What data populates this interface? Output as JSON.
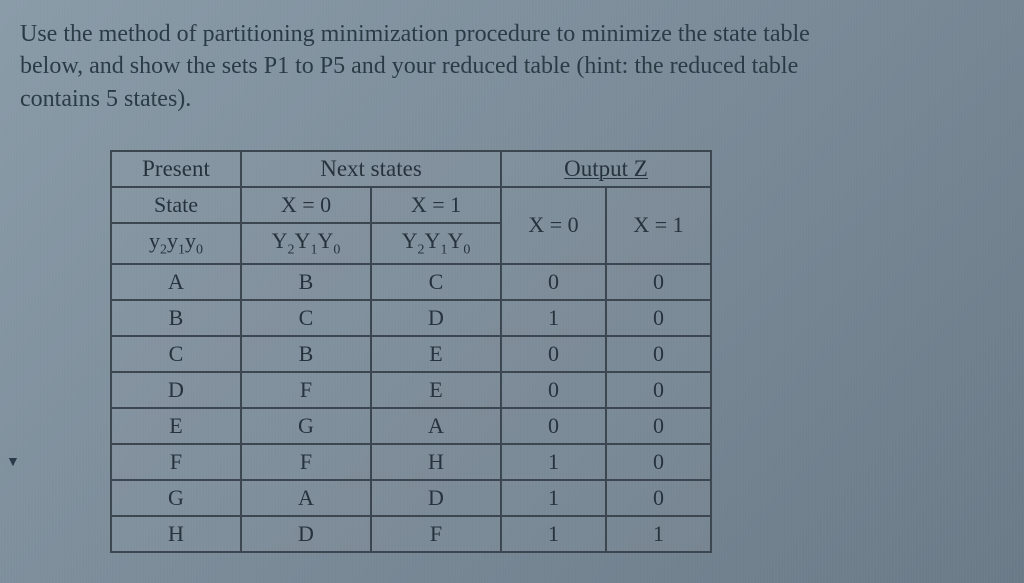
{
  "question": {
    "line1": "Use the method of partitioning minimization procedure to minimize the state table",
    "line2": "below, and show the sets P1 to P5 and your reduced table (hint: the reduced table",
    "line3": "contains 5 states)."
  },
  "table": {
    "headers": {
      "present_top": "Present",
      "present_mid": "State",
      "present_sub": "y₂y₁y₀",
      "next_top": "Next states",
      "next_x0": "X = 0",
      "next_x1": "X = 1",
      "next_sub": "Y₂Y₁Y₀",
      "output_top": "Output Z",
      "out_x0": "X = 0",
      "out_x1": "X = 1"
    },
    "rows": [
      {
        "state": "A",
        "nx0": "B",
        "nx1": "C",
        "z0": "0",
        "z1": "0"
      },
      {
        "state": "B",
        "nx0": "C",
        "nx1": "D",
        "z0": "1",
        "z1": "0"
      },
      {
        "state": "C",
        "nx0": "B",
        "nx1": "E",
        "z0": "0",
        "z1": "0"
      },
      {
        "state": "D",
        "nx0": "F",
        "nx1": "E",
        "z0": "0",
        "z1": "0"
      },
      {
        "state": "E",
        "nx0": "G",
        "nx1": "A",
        "z0": "0",
        "z1": "0"
      },
      {
        "state": "F",
        "nx0": "F",
        "nx1": "H",
        "z0": "1",
        "z1": "0"
      },
      {
        "state": "G",
        "nx0": "A",
        "nx1": "D",
        "z0": "1",
        "z1": "0"
      },
      {
        "state": "H",
        "nx0": "D",
        "nx1": "F",
        "z0": "1",
        "z1": "1"
      }
    ]
  },
  "chart_data": {
    "type": "table",
    "title": "State Transition Table",
    "columns": [
      "Present State (y2y1y0)",
      "Next State X=0 (Y2Y1Y0)",
      "Next State X=1 (Y2Y1Y0)",
      "Output Z X=0",
      "Output Z X=1"
    ],
    "rows": [
      [
        "A",
        "B",
        "C",
        0,
        0
      ],
      [
        "B",
        "C",
        "D",
        1,
        0
      ],
      [
        "C",
        "B",
        "E",
        0,
        0
      ],
      [
        "D",
        "F",
        "E",
        0,
        0
      ],
      [
        "E",
        "G",
        "A",
        0,
        0
      ],
      [
        "F",
        "F",
        "H",
        1,
        0
      ],
      [
        "G",
        "A",
        "D",
        1,
        0
      ],
      [
        "H",
        "D",
        "F",
        1,
        1
      ]
    ]
  }
}
